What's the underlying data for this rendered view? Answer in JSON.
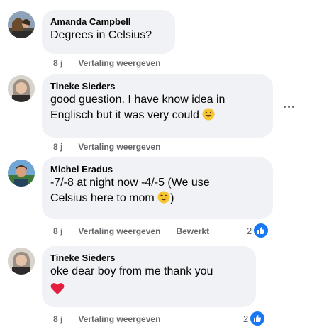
{
  "comments": [
    {
      "author": "Amanda Campbell",
      "text": "Degrees in Celsius?",
      "time": "8 j",
      "translate": "Vertaling weergeven"
    },
    {
      "author": "Tineke Sieders",
      "text_line1": "good guestion. I have know idea in",
      "text_line2": "Englisch but it was very could",
      "time": "8 j",
      "translate": "Vertaling weergeven"
    },
    {
      "author": "Michel Eradus",
      "text_line1": "-7/-8 at night now -4/-5 (We use",
      "text_line2a": "Celsius here to mom",
      "text_line2b": ")",
      "time": "8 j",
      "translate": "Vertaling weergeven",
      "edited": "Bewerkt",
      "reaction_count": "2",
      "reaction_icon": "like-icon"
    },
    {
      "author": "Tineke Sieders",
      "text": "oke dear boy from me thank you",
      "emoji": "heart-icon",
      "time": "8 j",
      "translate": "Vertaling weergeven",
      "reaction_count": "2",
      "reaction_icon": "like-icon"
    }
  ],
  "colors": {
    "bubble": "#f0f2f5",
    "meta_text": "#65676b",
    "like_blue": "#1877f2",
    "heart_red": "#e41e3f"
  }
}
